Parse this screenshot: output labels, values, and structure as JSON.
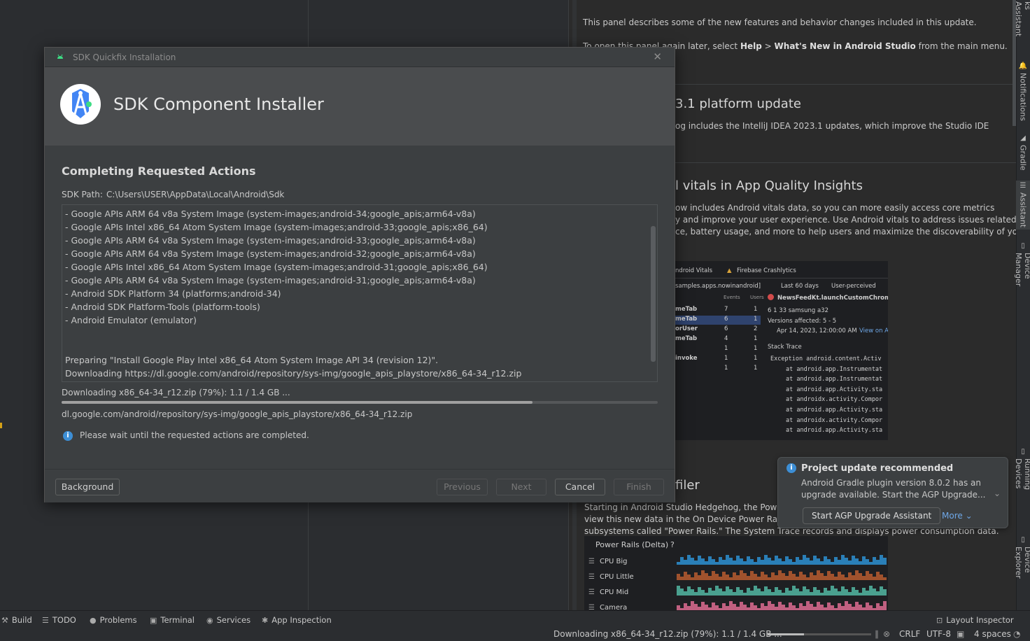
{
  "dialog": {
    "window_title": "SDK Quickfix Installation",
    "header_title": "SDK Component Installer",
    "section_title": "Completing Requested Actions",
    "sdk_path_label": "SDK Path:",
    "sdk_path_value": "C:\\Users\\USER\\AppData\\Local\\Android\\Sdk",
    "log_lines": [
      "- Google APIs ARM 64 v8a System Image (system-images;android-34;google_apis;arm64-v8a)",
      "- Google APIs Intel x86_64 Atom System Image (system-images;android-33;google_apis;x86_64)",
      "- Google APIs ARM 64 v8a System Image (system-images;android-33;google_apis;arm64-v8a)",
      "- Google APIs ARM 64 v8a System Image (system-images;android-32;google_apis;arm64-v8a)",
      "- Google APIs Intel x86_64 Atom System Image (system-images;android-31;google_apis;x86_64)",
      "- Google APIs ARM 64 v8a System Image (system-images;android-31;google_apis;arm64-v8a)",
      "- Android SDK Platform 34 (platforms;android-34)",
      "- Android SDK Platform-Tools (platform-tools)",
      "- Android Emulator (emulator)",
      "",
      "",
      "Preparing \"Install Google Play Intel x86_64 Atom System Image API 34 (revision 12)\".",
      "Downloading https://dl.google.com/android/repository/sys-img/google_apis_playstore/x86_64-34_r12.zip"
    ],
    "status_text": "Downloading x86_64-34_r12.zip (79%): 1.1 / 1.4 GB ...",
    "progress": 0.79,
    "url_text": "dl.google.com/android/repository/sys-img/google_apis_playstore/x86_64-34_r12.zip",
    "info_text": "Please wait until the requested actions are completed.",
    "buttons": {
      "background": "Background",
      "previous": "Previous",
      "next": "Next",
      "cancel": "Cancel",
      "finish": "Finish"
    }
  },
  "whats_new": {
    "intro_line": "This panel describes some of the new features and behavior changes included in this update.",
    "open_prefix": "To open this panel again later, select",
    "open_help": "Help",
    "open_sep": ">",
    "open_menu": "What's New in Android Studio",
    "open_suffix": "from the main menu.",
    "h_platform": "3.1 platform update",
    "platform_text": "og includes the IntelliJ IDEA 2023.1 updates, which improve the Studio IDE",
    "h_vitals": "l vitals in App Quality Insights",
    "vitals_lines": [
      "ow includes Android vitals data, so you can more easily access core metrics",
      "y and improve your user experience. Use Android vitals to address issues related to",
      "ce, battery usage, and more to help users and maximize the discoverability of your"
    ],
    "h_profiler": "filer",
    "profiler_lines": [
      "Starting in Android Studio Hedgehog, the Power Pr",
      "view this new data in the On Device Power Rails Mo",
      "subsystems called \"Power Rails.\" The System Trace records and displays power consumption data."
    ],
    "screenshot": {
      "tab_vitals": "ndroid Vitals",
      "tab_crashlytics": "Firebase Crashlytics",
      "filter_app": "samples.apps.nowinandroid]",
      "filter_days": "Last 60 days",
      "filter_user": "User-perceived",
      "col_events": "Events",
      "col_users": "Users",
      "issue_title": "NewsFeedKt.launchCustomChromeT",
      "rows": [
        {
          "name": "meTab",
          "events": "7",
          "users": "1"
        },
        {
          "name": "meTab",
          "events": "6",
          "users": "1"
        },
        {
          "name": "orUser",
          "events": "6",
          "users": "2"
        },
        {
          "name": "meTab",
          "events": "4",
          "users": "1"
        },
        {
          "name": "",
          "events": "1",
          "users": "1"
        },
        {
          "name": "invoke",
          "events": "1",
          "users": "1"
        },
        {
          "name": "",
          "events": "1",
          "users": "1"
        }
      ],
      "stats": "6   1   33   samsung a32",
      "versions": "Versions affected: 5 - 5",
      "date": "Apr 14, 2023, 12:00:00 AM",
      "view_on": "View on A",
      "stack_trace": "Stack Trace",
      "trace_lines": [
        "Exception android.content.Activ",
        "at android.app.Instrumentat",
        "at android.app.Instrumentat",
        "at android.app.Activity.sta",
        "at androidx.activity.Compor",
        "at android.app.Activity.sta",
        "at androidx.activity.Compor",
        "at android.app.Activity.sta"
      ]
    },
    "power_rails": {
      "title": "Power Rails (Delta)",
      "help": "?",
      "rows": [
        "CPU Big",
        "CPU Little",
        "CPU Mid",
        "Camera"
      ],
      "colors": [
        "#2a7fb8",
        "#a0522d",
        "#4aa08f",
        "#c06080"
      ]
    }
  },
  "notification": {
    "title": "Project update recommended",
    "message": "Android Gradle plugin version 8.0.2 has an upgrade available. Start the AGP Upgrade...",
    "action": "Start AGP Upgrade Assistant",
    "more": "More"
  },
  "right_stripe": [
    {
      "label": "ks Assistant",
      "icon": "assistant-icon"
    },
    {
      "label": "Notifications",
      "icon": "bell-icon"
    },
    {
      "label": "Gradle",
      "icon": "elephant-icon"
    },
    {
      "label": "Assistant",
      "icon": "list-icon"
    },
    {
      "label": "Device Manager",
      "icon": "device-icon"
    },
    {
      "label": "Running Devices",
      "icon": "device-icon"
    },
    {
      "label": "Device Explorer",
      "icon": "device-icon"
    }
  ],
  "bottom_tools": {
    "build": "Build",
    "todo": "TODO",
    "problems": "Problems",
    "terminal": "Terminal",
    "services": "Services",
    "app_inspection": "App Inspection",
    "layout_inspector": "Layout Inspector"
  },
  "statusbar": {
    "download": "Downloading x86_64-34_r12.zip (79%): 1.1 / 1.4 GB ...",
    "progress": 0.35,
    "line_sep": "CRLF",
    "encoding": "UTF-8",
    "indent": "4 spaces"
  }
}
